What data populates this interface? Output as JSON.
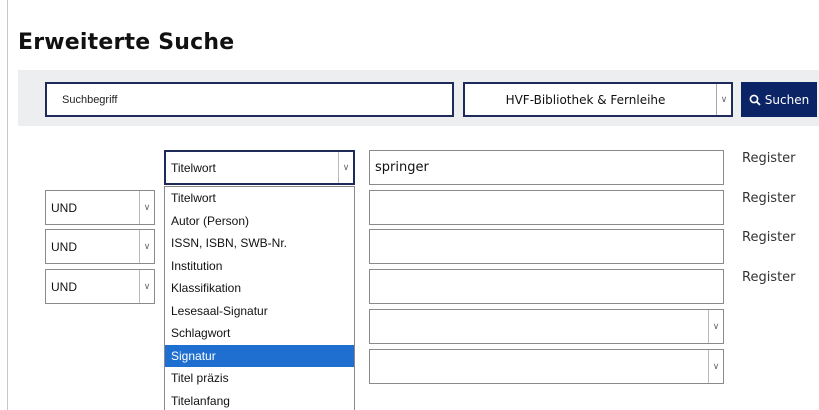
{
  "page": {
    "title": "Erweiterte Suche"
  },
  "search_bar": {
    "input_value": "Suchbegriff",
    "library_selected": "HVF-Bibliothek & Fernleihe",
    "search_button": "Suchen"
  },
  "rows": [
    {
      "operator": "",
      "field": "Titelwort",
      "term": "springer",
      "register": "Register"
    },
    {
      "operator": "UND",
      "field": "",
      "term": "",
      "register": "Register"
    },
    {
      "operator": "UND",
      "field": "",
      "term": "",
      "register": "Register"
    },
    {
      "operator": "UND",
      "field": "",
      "term": "",
      "register": "Register"
    }
  ],
  "field_dropdown": {
    "options": [
      "Titelwort",
      "Autor (Person)",
      "ISSN, ISBN, SWB-Nr.",
      "Institution",
      "Klassifikation",
      "Lesesaal-Signatur",
      "Schlagwort",
      "Signatur",
      "Titel präzis",
      "Titelanfang"
    ],
    "highlighted": "Signatur",
    "highlight_color": "#1f6fd1"
  },
  "colors": {
    "accent": "#0b2466",
    "border_dark": "#1e2a5a",
    "bar_background": "#eceef0"
  },
  "icons": {
    "search": "search-icon",
    "dropdown_arrow": "chevron-down-icon"
  }
}
